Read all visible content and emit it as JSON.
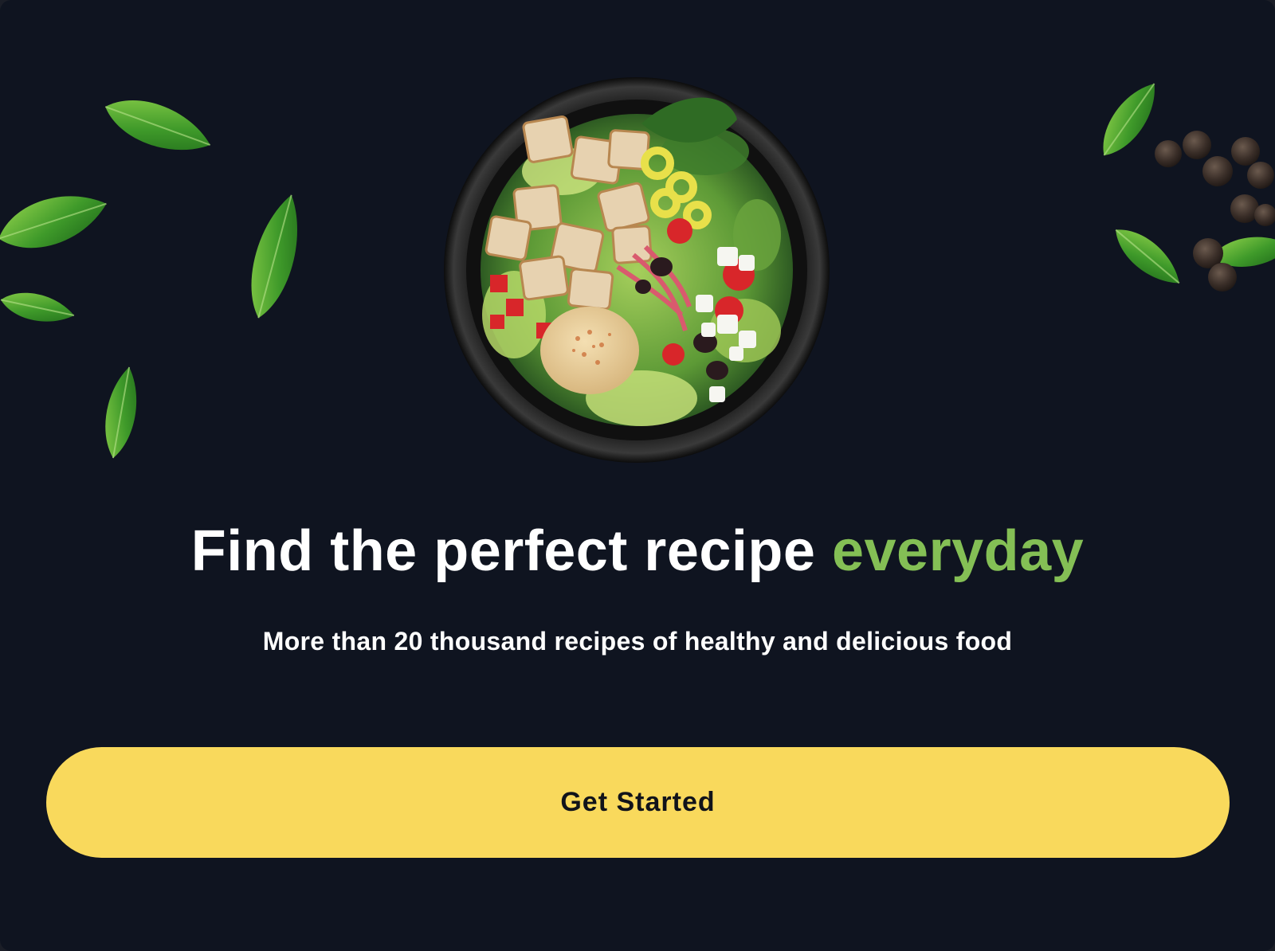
{
  "hero": {
    "image": "salad-bowl-image",
    "decorations": [
      "basil-leaf",
      "peppercorn"
    ]
  },
  "headline": {
    "text_main": "Find the perfect recipe ",
    "text_accent": "everyday"
  },
  "subtitle": {
    "text": "More than 20 thousand recipes of healthy and delicious food"
  },
  "cta": {
    "label": "Get Started"
  },
  "colors": {
    "background": "#0f1420",
    "accent_green": "#84bf55",
    "button_yellow": "#f9d95c",
    "button_text": "#11131a",
    "text_white": "#ffffff"
  }
}
